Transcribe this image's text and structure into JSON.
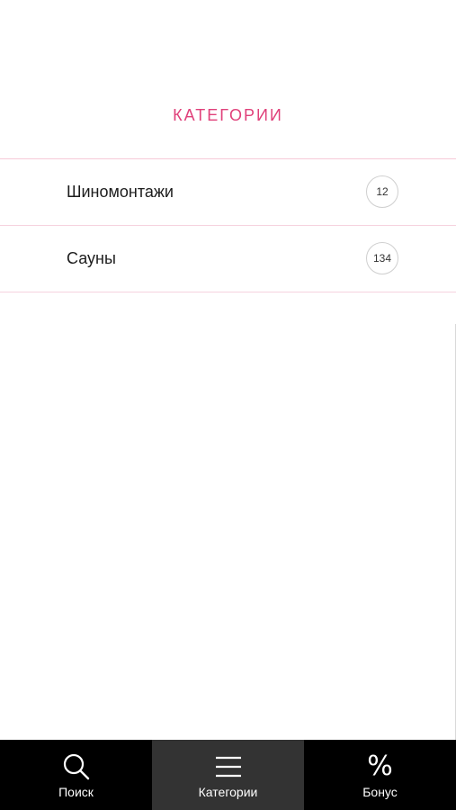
{
  "header": {
    "title": "КАТЕГОРИИ"
  },
  "categories": [
    {
      "label": "Шиномонтажи",
      "count": "12"
    },
    {
      "label": "Сауны",
      "count": "134"
    }
  ],
  "tabbar": {
    "tabs": [
      {
        "label": "Поиск",
        "icon": "search-icon",
        "active": false
      },
      {
        "label": "Категории",
        "icon": "menu-icon",
        "active": true
      },
      {
        "label": "Бонус",
        "icon": "percent-icon",
        "active": false
      }
    ],
    "percent_glyph": "%"
  },
  "colors": {
    "accent": "#e0407a",
    "tabbar_bg": "#000000",
    "tab_active_bg": "#333333",
    "divider": "#f6d3df"
  }
}
